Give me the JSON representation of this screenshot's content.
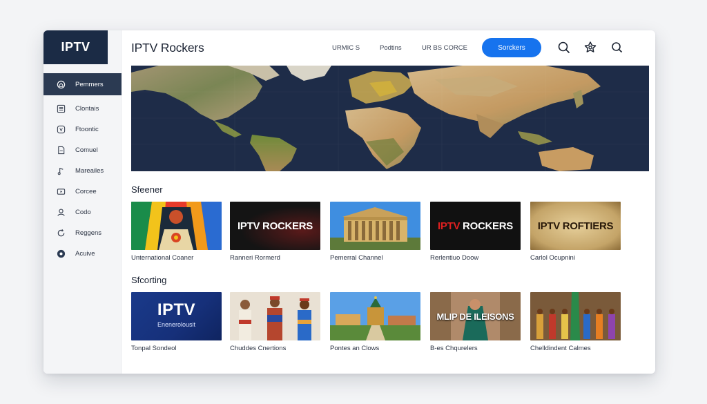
{
  "app": {
    "logo": "IPTV",
    "title": "IPTV Rockers"
  },
  "sidebar": {
    "items": [
      {
        "label": "Pemmers",
        "icon": "home-icon",
        "active": true
      },
      {
        "label": "Clontais",
        "icon": "list-icon"
      },
      {
        "label": "Ftoontic",
        "icon": "badge-icon"
      },
      {
        "label": "Comuel",
        "icon": "document-icon"
      },
      {
        "label": "Mareailes",
        "icon": "music-icon"
      },
      {
        "label": "Corcee",
        "icon": "play-icon"
      },
      {
        "label": "Codo",
        "icon": "user-icon"
      },
      {
        "label": "Reggens",
        "icon": "refresh-icon"
      },
      {
        "label": "Acuive",
        "icon": "record-icon"
      }
    ]
  },
  "topbar": {
    "links": [
      "URMIC S",
      "Podtins",
      "UR BS CORCE"
    ],
    "cta_label": "Sorckers",
    "icons": [
      "search-icon",
      "settings-icon",
      "search-icon"
    ]
  },
  "sections": [
    {
      "title": "Sfeener",
      "cards": [
        {
          "caption": "Unternational Coaner",
          "thumb_text": ""
        },
        {
          "caption": "Ranneri Rormerd",
          "thumb_text": "IPTV ROCKERS"
        },
        {
          "caption": "Pemerral Channel",
          "thumb_text": ""
        },
        {
          "caption": "Rerlentiuo Doow",
          "thumb_text": "IPTV ROCKERS"
        },
        {
          "caption": "Carlol Ocupnini",
          "thumb_text": "IPTV ROFTIERS"
        }
      ]
    },
    {
      "title": "Sfcorting",
      "cards": [
        {
          "caption": "Tonpal Sondeol",
          "thumb_text": "IPTV",
          "thumb_subtext": "Enenerolousit"
        },
        {
          "caption": "Chuddes Cnertions",
          "thumb_text": ""
        },
        {
          "caption": "Pontes an Clows",
          "thumb_text": ""
        },
        {
          "caption": "B-es Chqurelers",
          "thumb_text": "MLIP DE ILEISONS"
        },
        {
          "caption": "Chelldindent Calmes",
          "thumb_text": ""
        }
      ]
    }
  ],
  "colors": {
    "accent": "#1673ee",
    "logo_bg": "#1b2b45",
    "active_nav": "#2b3a52",
    "map_ocean": "#1e2c48"
  }
}
